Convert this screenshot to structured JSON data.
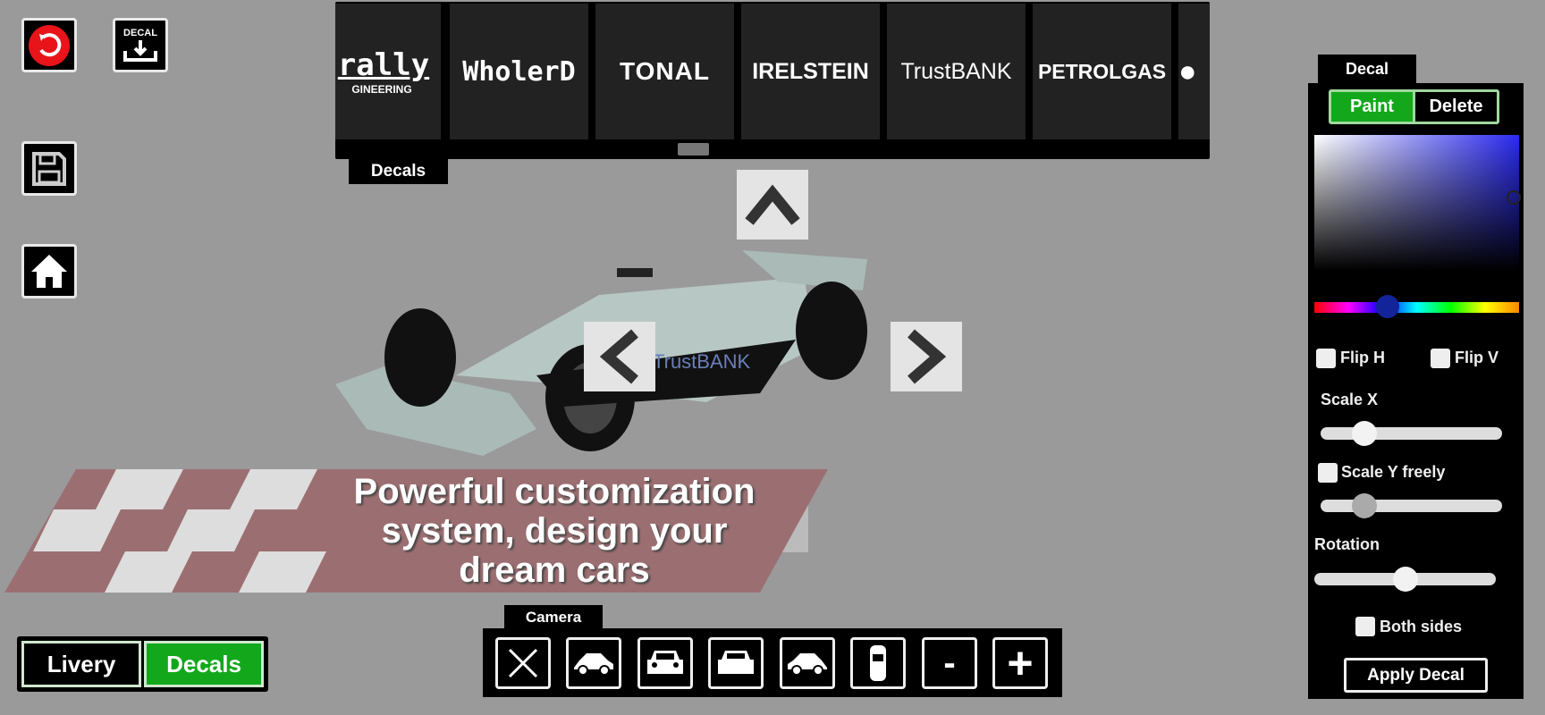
{
  "toolbar": {
    "undo_icon": "undo-icon",
    "decal_download_label": "DECAL",
    "save_icon": "floppy-disk-icon",
    "home_icon": "home-icon"
  },
  "decals": {
    "tab_label": "Decals",
    "items": [
      {
        "top": "rally",
        "bottom": "GINEERING"
      },
      {
        "top": "WholerD"
      },
      {
        "top": "TONAL"
      },
      {
        "top": "IRELSTEIN"
      },
      {
        "top": "TrustBANK"
      },
      {
        "top": "PETROLGAS"
      },
      {
        "top": "●"
      }
    ]
  },
  "banner": {
    "lines": [
      "Powerful customization",
      "system, design your",
      "dream cars"
    ],
    "color": "#9b6f72"
  },
  "mode": {
    "livery": "Livery",
    "decals": "Decals",
    "selected": "Decals",
    "accent": "#13a81c"
  },
  "camera": {
    "tab_label": "Camera",
    "buttons": [
      "close-icon",
      "car-side-icon",
      "car-front-icon",
      "car-rear-icon",
      "car-side-rear-icon",
      "car-top-icon",
      "minus-icon",
      "plus-icon"
    ],
    "minus": "-",
    "plus": "+"
  },
  "decal_panel": {
    "tab_label": "Decal",
    "paint": "Paint",
    "delete": "Delete",
    "selected_mode": "Paint",
    "color_hex": "#2a2ad8",
    "hue_position": 0.36,
    "flip_h": "Flip H",
    "flip_v": "Flip V",
    "scale_x_label": "Scale X",
    "scale_x_value": 0.24,
    "scale_y_label": "Scale Y freely",
    "scale_y_value": 0.24,
    "rotation_label": "Rotation",
    "rotation_value": 0.5,
    "both_sides": "Both sides",
    "apply": "Apply Decal"
  }
}
